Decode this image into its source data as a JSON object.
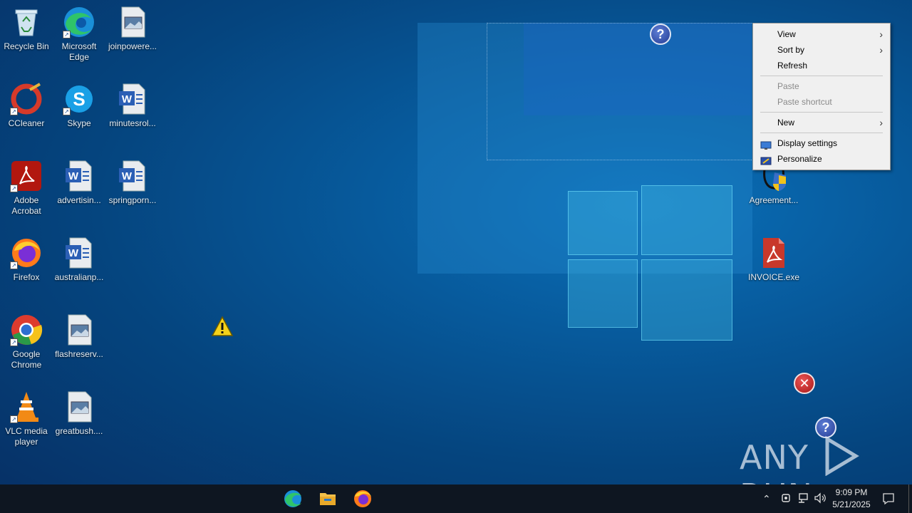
{
  "desktop_icons": [
    {
      "label": "Recycle Bin",
      "icon": "recycle-bin-icon"
    },
    {
      "label": "Microsoft Edge",
      "icon": "edge-icon"
    },
    {
      "label": "joinpowere...",
      "icon": "image-file-icon"
    },
    {
      "label": "CCleaner",
      "icon": "ccleaner-icon"
    },
    {
      "label": "Skype",
      "icon": "skype-icon"
    },
    {
      "label": "minutesrol...",
      "icon": "word-doc-icon"
    },
    {
      "label": "Adobe Acrobat",
      "icon": "acrobat-icon"
    },
    {
      "label": "advertisin...",
      "icon": "word-doc-icon"
    },
    {
      "label": "springporn...",
      "icon": "word-doc-icon"
    },
    {
      "label": "Firefox",
      "icon": "firefox-icon"
    },
    {
      "label": "australianp...",
      "icon": "word-doc-icon"
    },
    {
      "label": "Google Chrome",
      "icon": "chrome-icon"
    },
    {
      "label": "flashreserv...",
      "icon": "image-file-icon"
    },
    {
      "label": "VLC media player",
      "icon": "vlc-icon"
    },
    {
      "label": "greatbush....",
      "icon": "image-file-icon"
    },
    {
      "label": "Agreement...",
      "icon": "agreement-exe-icon"
    },
    {
      "label": "INVOICE.exe",
      "icon": "invoice-exe-icon"
    }
  ],
  "context_menu": {
    "items": [
      {
        "label": "View",
        "submenu": true,
        "enabled": true
      },
      {
        "label": "Sort by",
        "submenu": true,
        "enabled": true
      },
      {
        "label": "Refresh",
        "submenu": false,
        "enabled": true
      },
      {
        "label": "Paste",
        "submenu": false,
        "enabled": false
      },
      {
        "label": "Paste shortcut",
        "submenu": false,
        "enabled": false
      },
      {
        "label": "New",
        "submenu": true,
        "enabled": true
      },
      {
        "label": "Display settings",
        "submenu": false,
        "enabled": true,
        "icon": "display-settings-icon"
      },
      {
        "label": "Personalize",
        "submenu": false,
        "enabled": true,
        "icon": "personalize-icon"
      }
    ]
  },
  "taskbar": {
    "apps": [
      "edge-icon",
      "file-explorer-icon",
      "firefox-icon"
    ],
    "time": "9:09 PM",
    "date": "5/21/2025"
  },
  "watermark": {
    "text_left": "ANY",
    "text_right": "RUN"
  },
  "colors": {
    "taskbar_bg": "#0e1621",
    "menu_bg": "#f0f0f0",
    "desktop_bg": "#075a9c"
  }
}
